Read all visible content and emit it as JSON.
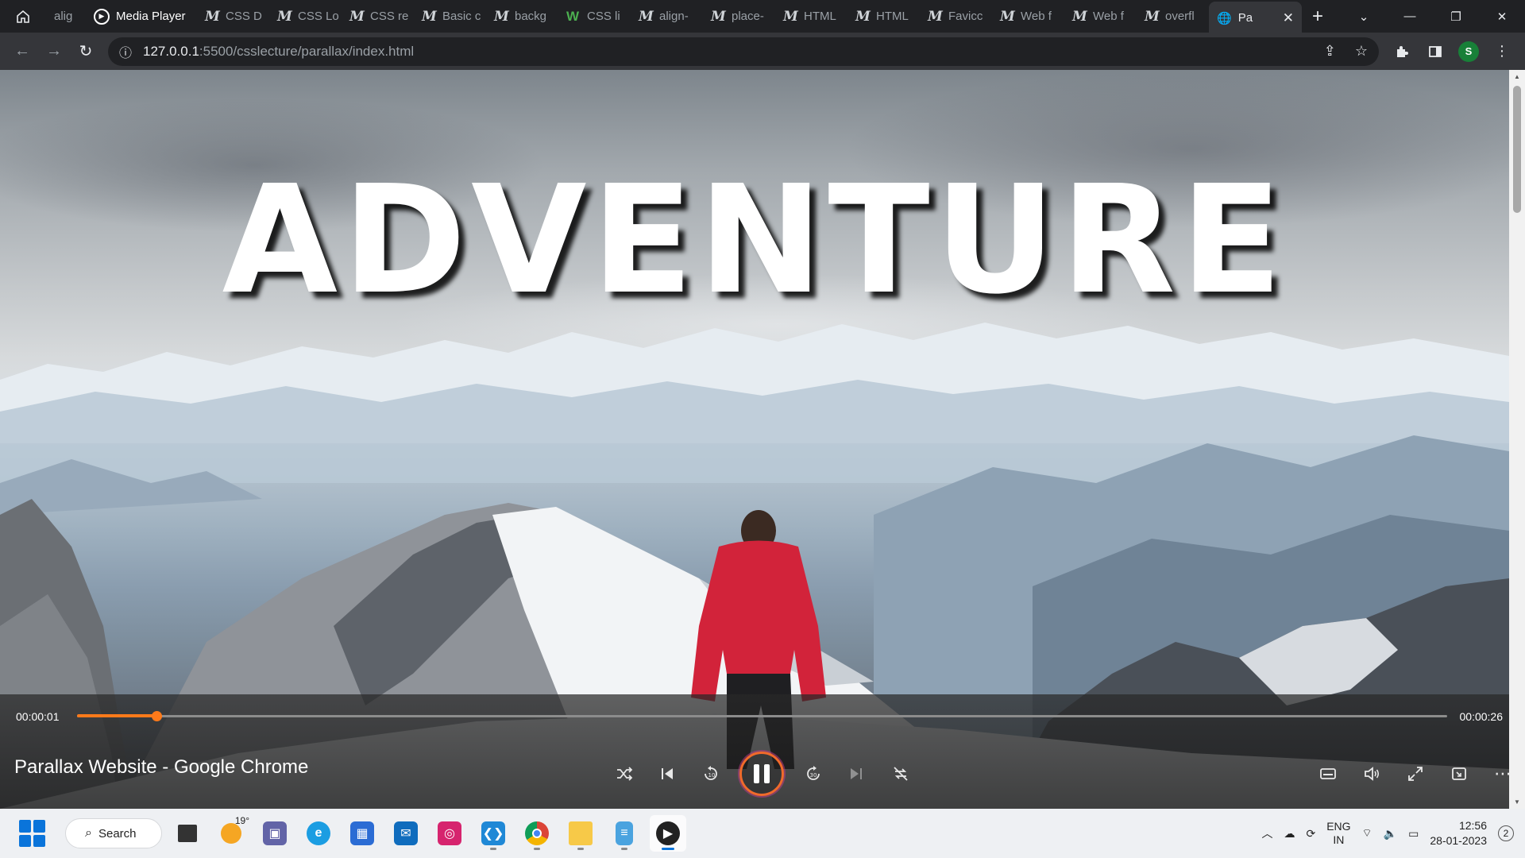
{
  "browser": {
    "tabs": [
      {
        "label": "alig",
        "icon": "m-icon"
      },
      {
        "label": "CSS D",
        "icon": "m-icon"
      },
      {
        "label": "CSS Lo",
        "icon": "m-icon"
      },
      {
        "label": "CSS re",
        "icon": "m-icon"
      },
      {
        "label": "Basic c",
        "icon": "m-icon"
      },
      {
        "label": "backg",
        "icon": "m-icon"
      },
      {
        "label": "CSS li",
        "icon": "w-icon"
      },
      {
        "label": "align-",
        "icon": "m-icon"
      },
      {
        "label": "place-",
        "icon": "m-icon"
      },
      {
        "label": "HTML",
        "icon": "m-icon"
      },
      {
        "label": "HTML",
        "icon": "m-icon"
      },
      {
        "label": "Favicc",
        "icon": "m-icon"
      },
      {
        "label": "Web f",
        "icon": "m-icon"
      },
      {
        "label": "Web f",
        "icon": "m-icon"
      },
      {
        "label": "overfl",
        "icon": "m-icon"
      }
    ],
    "media_tab_label": "Media Player",
    "active_tab_label": "Pa",
    "url_host": "127.0.0.1",
    "url_path": ":5500/csslecture/parallax/index.html",
    "profile_initial": "S"
  },
  "page": {
    "headline": "ADVENTURE"
  },
  "player": {
    "current_time": "00:00:01",
    "total_time": "00:00:26",
    "progress_fraction": 0.058,
    "title": "Parallax Website - Google Chrome",
    "accent_color": "#ff7a1a"
  },
  "taskbar": {
    "search_label": "Search",
    "weather_temp": "19°",
    "lang_line1": "ENG",
    "lang_line2": "IN",
    "time": "12:56",
    "date": "28-01-2023",
    "notification_count": "2"
  }
}
